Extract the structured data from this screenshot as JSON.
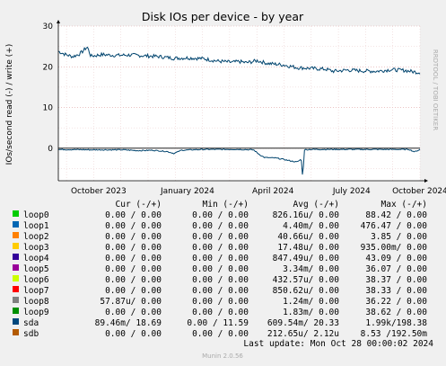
{
  "chart_data": {
    "type": "line",
    "title": "Disk IOs per device - by year",
    "ylabel": "IOs/second read (-) / write (+)",
    "ylim": [
      -8,
      30
    ],
    "yticks": [
      0,
      10,
      20,
      30
    ],
    "xticks": [
      "October 2023",
      "January 2024",
      "April 2024",
      "July 2024",
      "October 2024"
    ],
    "watermark": "RRDTOOL / TOBI OETIKER",
    "series": [
      {
        "name": "sda",
        "color": "#00446e",
        "write_points": [
          [
            0,
            23.8
          ],
          [
            0.02,
            23.0
          ],
          [
            0.04,
            22.5
          ],
          [
            0.06,
            23.2
          ],
          [
            0.08,
            24.9
          ],
          [
            0.09,
            22.6
          ],
          [
            0.12,
            23.0
          ],
          [
            0.16,
            22.8
          ],
          [
            0.2,
            22.9
          ],
          [
            0.24,
            22.7
          ],
          [
            0.28,
            22.5
          ],
          [
            0.32,
            22.1
          ],
          [
            0.36,
            22.2
          ],
          [
            0.4,
            22.0
          ],
          [
            0.44,
            21.4
          ],
          [
            0.48,
            21.1
          ],
          [
            0.5,
            21.3
          ],
          [
            0.52,
            21.0
          ],
          [
            0.55,
            21.5
          ],
          [
            0.58,
            20.8
          ],
          [
            0.62,
            20.5
          ],
          [
            0.66,
            19.8
          ],
          [
            0.7,
            19.6
          ],
          [
            0.74,
            19.4
          ],
          [
            0.76,
            18.9
          ],
          [
            0.8,
            19.2
          ],
          [
            0.84,
            19.0
          ],
          [
            0.88,
            18.9
          ],
          [
            0.92,
            19.3
          ],
          [
            0.96,
            19.1
          ],
          [
            0.98,
            18.8
          ],
          [
            1.0,
            18.6
          ]
        ],
        "read_points": [
          [
            0,
            -0.3
          ],
          [
            0.1,
            -0.4
          ],
          [
            0.18,
            -0.4
          ],
          [
            0.22,
            -0.6
          ],
          [
            0.26,
            -0.5
          ],
          [
            0.3,
            -0.8
          ],
          [
            0.32,
            -1.3
          ],
          [
            0.34,
            -0.5
          ],
          [
            0.4,
            -0.3
          ],
          [
            0.5,
            -0.3
          ],
          [
            0.54,
            -0.4
          ],
          [
            0.555,
            -1.5
          ],
          [
            0.57,
            -2.3
          ],
          [
            0.6,
            -2.4
          ],
          [
            0.62,
            -2.7
          ],
          [
            0.64,
            -3.1
          ],
          [
            0.66,
            -3.4
          ],
          [
            0.672,
            -2.7
          ],
          [
            0.676,
            -7.8
          ],
          [
            0.68,
            -0.4
          ],
          [
            0.7,
            -0.3
          ],
          [
            0.8,
            -0.3
          ],
          [
            0.9,
            -0.3
          ],
          [
            0.97,
            -0.3
          ],
          [
            0.985,
            -0.9
          ],
          [
            1.0,
            -0.3
          ]
        ]
      }
    ]
  },
  "table": {
    "header": {
      "cur": "Cur (-/+)",
      "min": "Min (-/+)",
      "avg": "Avg (-/+)",
      "max": "Max (-/+)"
    },
    "rows": [
      {
        "name": "loop0",
        "color": "#00cc00",
        "cur": "0.00 /  0.00",
        "min": "0.00 /  0.00",
        "avg": "826.16u/  0.00",
        "max": "88.42 /  0.00"
      },
      {
        "name": "loop1",
        "color": "#0066b3",
        "cur": "0.00 /  0.00",
        "min": "0.00 /  0.00",
        "avg": "4.40m/  0.00",
        "max": "476.47 /  0.00"
      },
      {
        "name": "loop2",
        "color": "#ff8000",
        "cur": "0.00 /  0.00",
        "min": "0.00 /  0.00",
        "avg": "40.66u/  0.00",
        "max": "3.85 /  0.00"
      },
      {
        "name": "loop3",
        "color": "#ffcc00",
        "cur": "0.00 /  0.00",
        "min": "0.00 /  0.00",
        "avg": "17.48u/  0.00",
        "max": "935.00m/  0.00"
      },
      {
        "name": "loop4",
        "color": "#330099",
        "cur": "0.00 /  0.00",
        "min": "0.00 /  0.00",
        "avg": "847.49u/  0.00",
        "max": "43.09 /  0.00"
      },
      {
        "name": "loop5",
        "color": "#990099",
        "cur": "0.00 /  0.00",
        "min": "0.00 /  0.00",
        "avg": "3.34m/  0.00",
        "max": "36.07 /  0.00"
      },
      {
        "name": "loop6",
        "color": "#ccff00",
        "cur": "0.00 /  0.00",
        "min": "0.00 /  0.00",
        "avg": "432.57u/  0.00",
        "max": "38.37 /  0.00"
      },
      {
        "name": "loop7",
        "color": "#ff0000",
        "cur": "0.00 /  0.00",
        "min": "0.00 /  0.00",
        "avg": "850.62u/  0.00",
        "max": "38.33 /  0.00"
      },
      {
        "name": "loop8",
        "color": "#808080",
        "cur": "57.87u/  0.00",
        "min": "0.00 /  0.00",
        "avg": "1.24m/  0.00",
        "max": "36.22 /  0.00"
      },
      {
        "name": "loop9",
        "color": "#008f00",
        "cur": "0.00 /  0.00",
        "min": "0.00 /  0.00",
        "avg": "1.83m/  0.00",
        "max": "38.62 /  0.00"
      },
      {
        "name": "sda",
        "color": "#00487d",
        "cur": "89.46m/ 18.69",
        "min": "0.00 / 11.59",
        "avg": "609.54m/ 20.33",
        "max": "1.99k/198.38"
      },
      {
        "name": "sdb",
        "color": "#b35a00",
        "cur": "0.00 /  0.00",
        "min": "0.00 /  0.00",
        "avg": "212.65u/  2.12u",
        "max": "8.53 /192.50m"
      }
    ]
  },
  "last_update": "Last update: Mon Oct 28 00:00:02 2024",
  "footer": "Munin 2.0.56"
}
